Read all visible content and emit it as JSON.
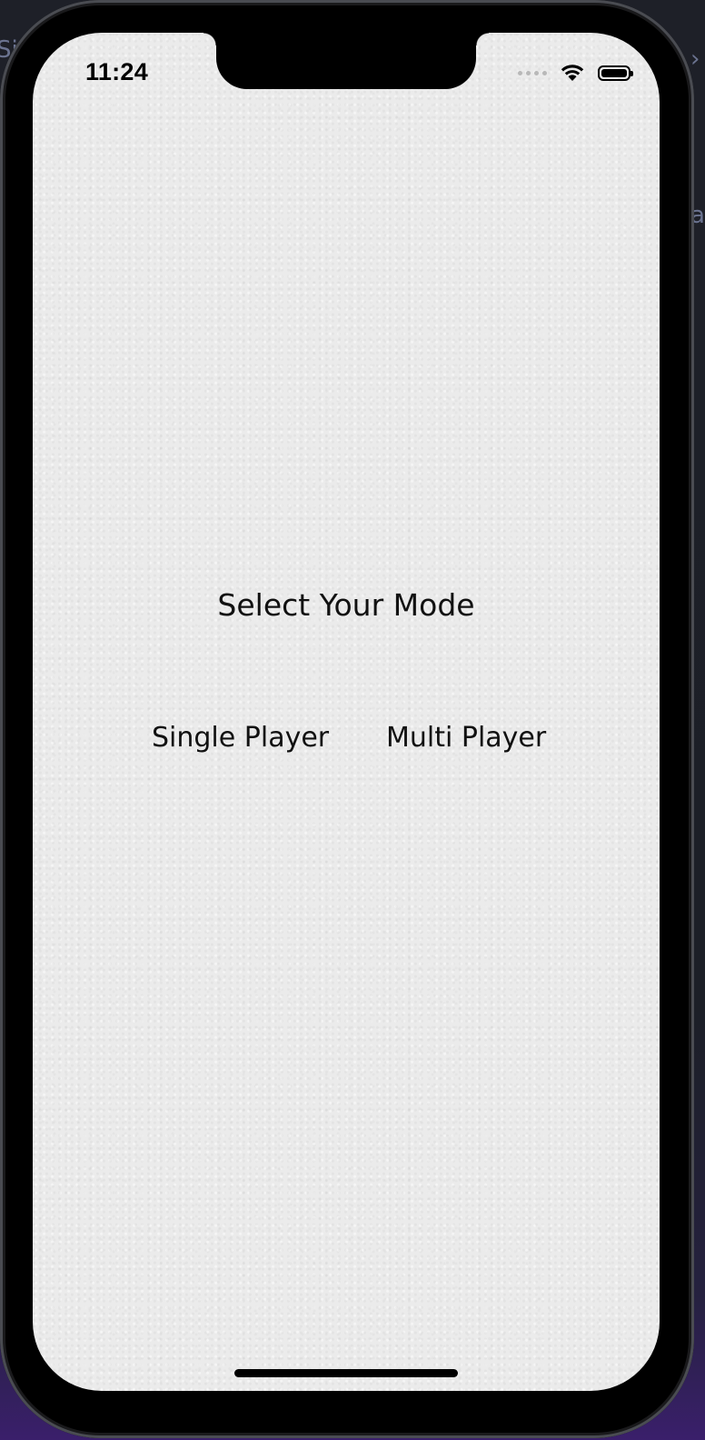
{
  "status_bar": {
    "time": "11:24",
    "battery_level": 1.0,
    "icons": [
      "cellular-signal-icon",
      "wifi-icon",
      "battery-icon"
    ]
  },
  "main": {
    "title": "Select Your Mode",
    "buttons": [
      {
        "label": "Single Player"
      },
      {
        "label": "Multi Player"
      }
    ]
  },
  "colors": {
    "screen_background": "#ebebeb",
    "text": "#111111",
    "device_frame": "#000000"
  }
}
